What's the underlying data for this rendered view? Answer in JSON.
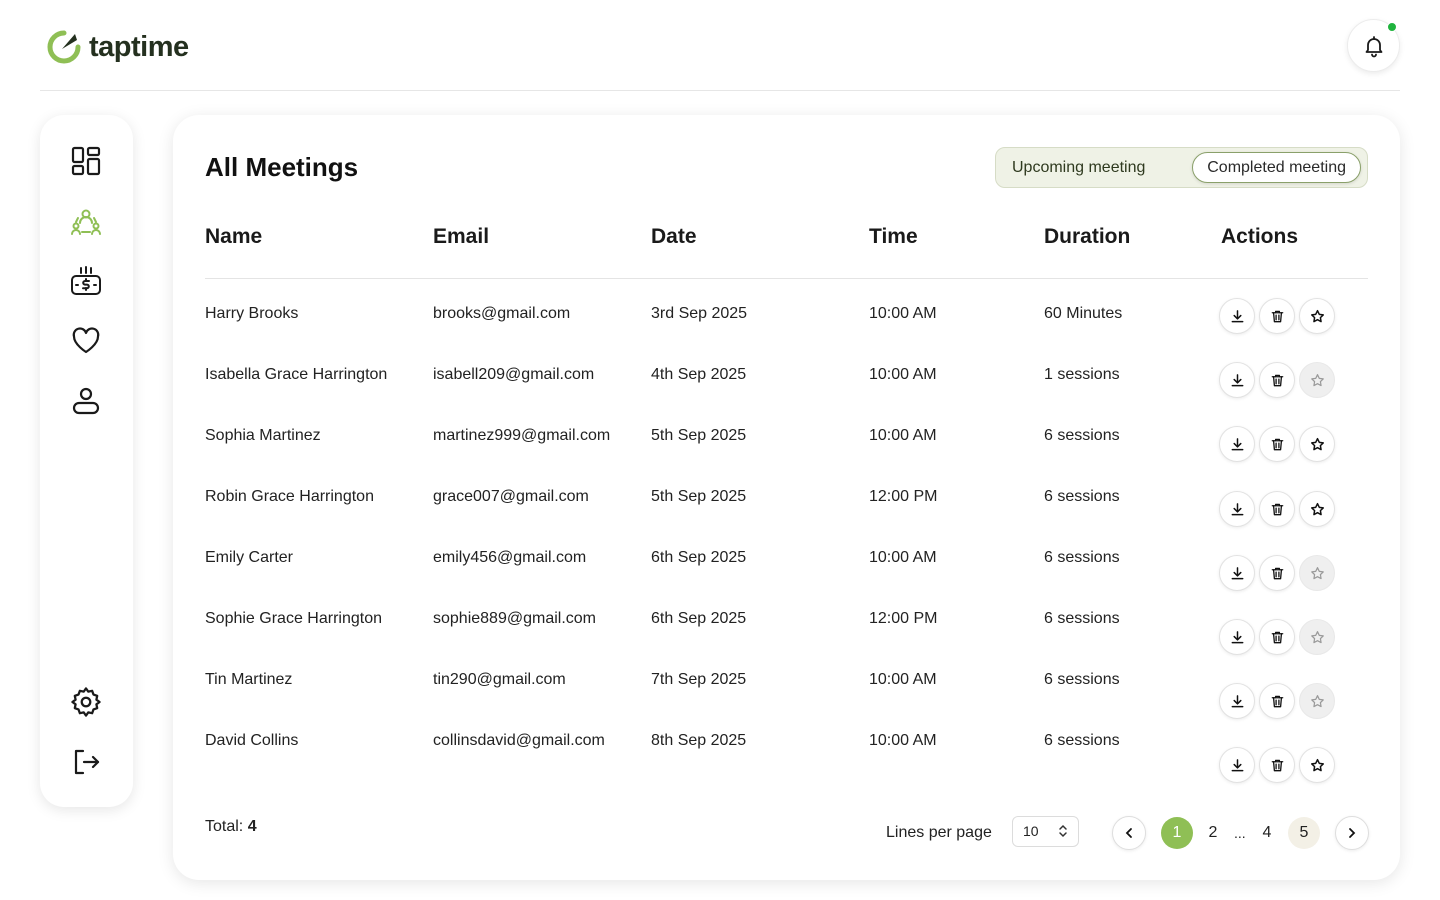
{
  "app": {
    "name": "taptime"
  },
  "header": {
    "notification_icon": "bell-icon",
    "has_unread": true
  },
  "sidebar": {
    "items": [
      {
        "name": "dashboard",
        "icon": "dashboard-grid-icon",
        "active": false
      },
      {
        "name": "meetings",
        "icon": "group-meeting-icon",
        "active": true
      },
      {
        "name": "payments",
        "icon": "payment-icon",
        "active": false
      },
      {
        "name": "favorites",
        "icon": "heart-icon",
        "active": false
      },
      {
        "name": "profile",
        "icon": "user-icon",
        "active": false
      },
      {
        "name": "settings",
        "icon": "gear-icon",
        "active": false
      },
      {
        "name": "logout",
        "icon": "logout-icon",
        "active": false
      }
    ]
  },
  "main": {
    "title": "All Meetings",
    "tabs": [
      {
        "label": "Upcoming meeting",
        "active": false
      },
      {
        "label": "Completed meeting",
        "active": true
      }
    ],
    "columns": [
      "Name",
      "Email",
      "Date",
      "Time",
      "Duration",
      "Actions"
    ],
    "rows": [
      {
        "name": "Harry Brooks",
        "email": "brooks@gmail.com",
        "date": "3rd Sep 2025",
        "time": "10:00 AM",
        "duration": "60 Minutes",
        "starred": true
      },
      {
        "name": "Isabella Grace Harrington",
        "email": "isabell209@gmail.com",
        "date": "4th Sep 2025",
        "time": "10:00 AM",
        "duration": "1 sessions",
        "starred": false
      },
      {
        "name": "Sophia Martinez",
        "email": "martinez999@gmail.com",
        "date": "5th Sep 2025",
        "time": "10:00 AM",
        "duration": "6 sessions",
        "starred": true
      },
      {
        "name": "Robin Grace Harrington",
        "email": "grace007@gmail.com",
        "date": "5th Sep 2025",
        "time": "12:00 PM",
        "duration": "6 sessions",
        "starred": true
      },
      {
        "name": "Emily Carter",
        "email": "emily456@gmail.com",
        "date": "6th Sep 2025",
        "time": "10:00 AM",
        "duration": "6 sessions",
        "starred": false
      },
      {
        "name": "Sophie Grace Harrington",
        "email": "sophie889@gmail.com",
        "date": "6th Sep 2025",
        "time": "12:00 PM",
        "duration": "6 sessions",
        "starred": false
      },
      {
        "name": "Tin Martinez",
        "email": "tin290@gmail.com",
        "date": "7th Sep 2025",
        "time": "10:00 AM",
        "duration": "6 sessions",
        "starred": false
      },
      {
        "name": "David Collins",
        "email": "collinsdavid@gmail.com",
        "date": "8th Sep 2025",
        "time": "10:00 AM",
        "duration": "6 sessions",
        "starred": true
      }
    ],
    "footer": {
      "total_label": "Total:",
      "total_value": "4",
      "lines_per_page_label": "Lines per page",
      "lines_per_page_value": "10",
      "pages": [
        "1",
        "2",
        "...",
        "4",
        "5"
      ],
      "current_page": "1"
    }
  },
  "colors": {
    "accent": "#8fbf55",
    "brand_dark": "#24301f",
    "notification_dot": "#1fb33d"
  }
}
